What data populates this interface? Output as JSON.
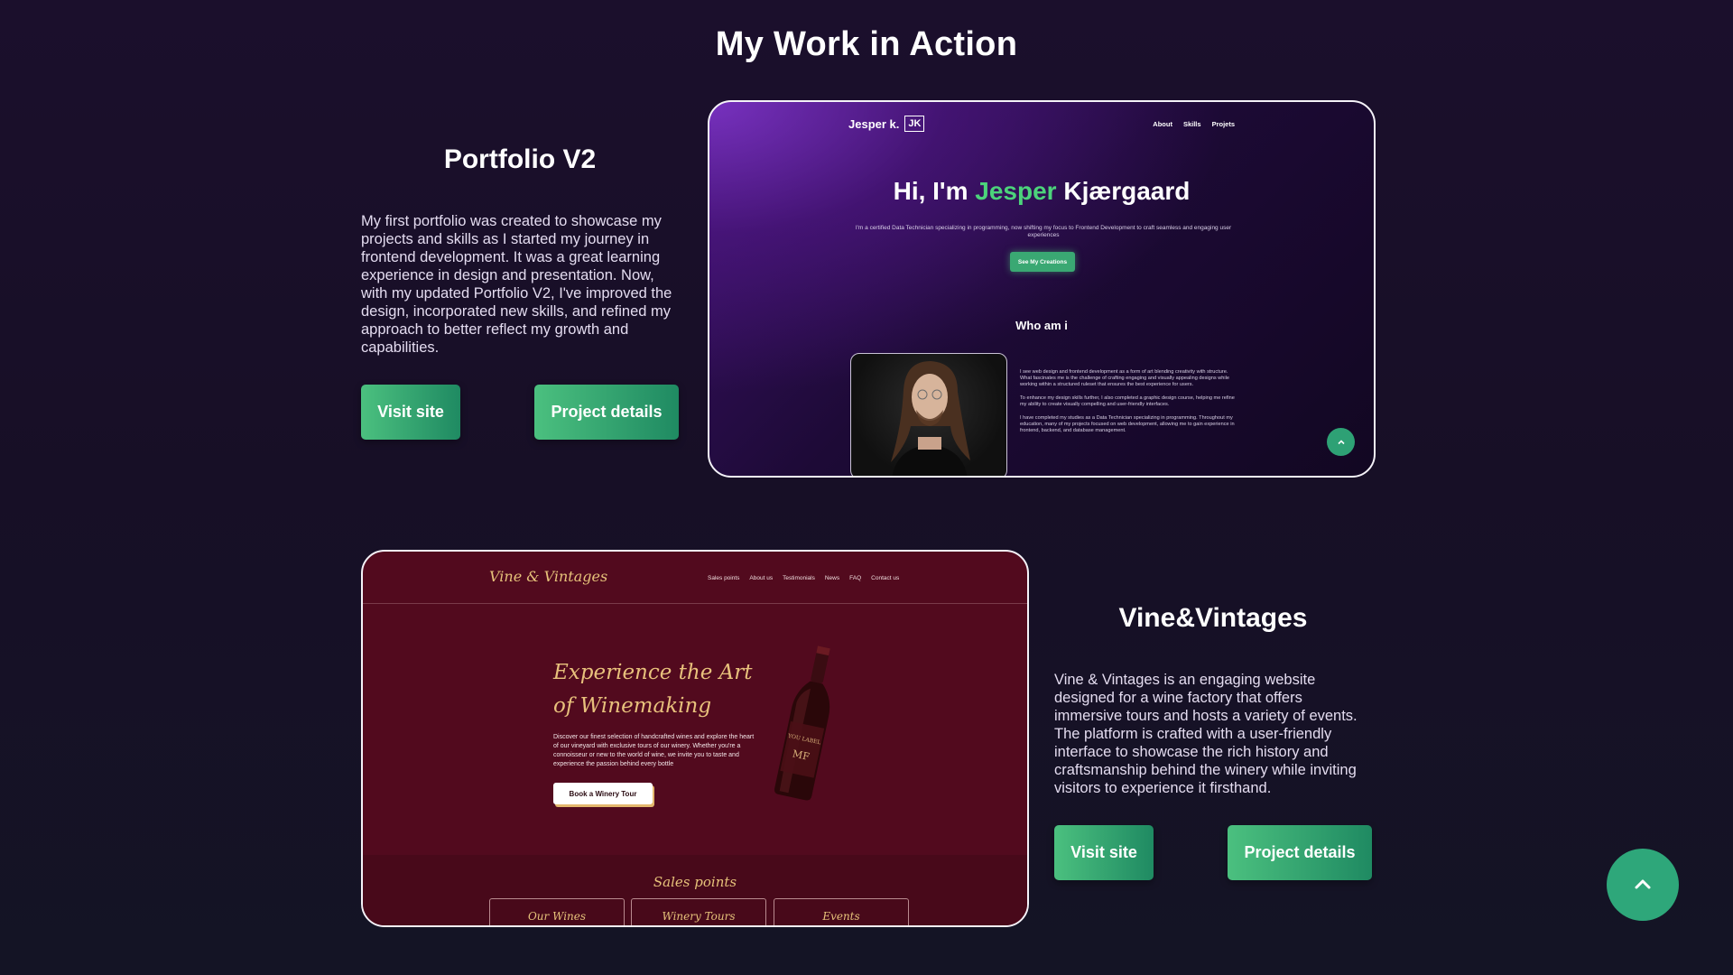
{
  "section": {
    "title": "My Work in Action"
  },
  "projects": [
    {
      "title": "Portfolio V2",
      "description": "My first portfolio was created to showcase my projects and skills as I started my journey in frontend development. It was a great learning experience in design and presentation. Now, with my updated Portfolio V2, I've improved the design, incorporated new skills, and refined my approach to better reflect my growth and capabilities.",
      "visit_label": "Visit site",
      "details_label": "Project details"
    },
    {
      "title": "Vine&Vintages",
      "description": "Vine & Vintages is an engaging website designed for a wine factory that offers immersive tours and hosts a variety of events. The platform is crafted with a user-friendly interface to showcase the rich history and craftsmanship behind the winery while inviting visitors to experience it firsthand.",
      "visit_label": "Visit site",
      "details_label": "Project details"
    }
  ],
  "portfolio_preview": {
    "logo_name": "Jesper k.",
    "logo_mark": "JK",
    "nav": [
      "About",
      "Skills",
      "Projets"
    ],
    "hero_prefix": "Hi, I'm ",
    "hero_accent": "Jesper",
    "hero_suffix": " Kjærgaard",
    "subtitle": "I'm a certified Data Technician specializing in programming, now shifting my focus to Frontend Development to craft seamless and engaging user experiences",
    "cta": "See My Creations",
    "who_title": "Who am i",
    "paragraphs": [
      "I see web design and frontend development as a form of art blending creativity with structure. What fascinates me is the challenge of crafting engaging and visually appealing designs while working within a structured ruleset that ensures the best experience for users.",
      "To enhance my design skills further, I also completed a graphic design course, helping me refine my ability to create visually compelling and user-friendly interfaces.",
      "I have completed my studies as a Data Technician specializing in programming. Throughout my education, many of my projects focused on web development, allowing me to gain experience in frontend, backend, and database management."
    ]
  },
  "wine_preview": {
    "logo": "Vine & Vintages",
    "nav": [
      "Sales points",
      "About us",
      "Testimonials",
      "News",
      "FAQ",
      "Contact us"
    ],
    "hero": "Experience the Art of Winemaking",
    "paragraph": "Discover our finest selection of handcrafted wines and explore the heart of our vineyard with exclusive tours of our winery. Whether you're a connoisseur or new to the world of wine, we invite you to taste and experience the passion behind every bottle",
    "cta": "Book a Winery Tour",
    "bottle_label": "YOU LABEL",
    "bottle_mark": "MF",
    "sales_title": "Sales points",
    "cards": [
      "Our Wines",
      "Winery Tours",
      "Events"
    ]
  },
  "icons": {
    "scroll_top": "chevron-up-icon"
  },
  "colors": {
    "accent_green": "#3aa873",
    "wine_red": "#520a1e",
    "gold": "#e6c27a"
  }
}
